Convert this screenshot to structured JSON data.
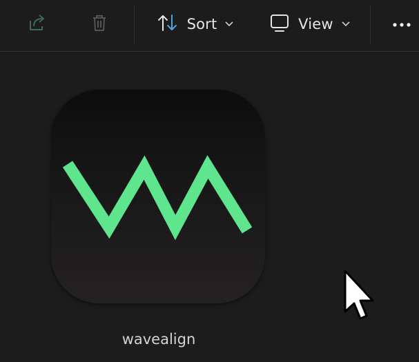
{
  "toolbar": {
    "share_icon": "share-icon",
    "delete_icon": "trash-icon",
    "sort_label": "Sort",
    "view_label": "View",
    "more_icon": "ellipsis-icon"
  },
  "files": [
    {
      "name": "wavealign",
      "icon": "wavealign-app-icon"
    }
  ],
  "colors": {
    "background": "#1c1c1c",
    "accent_green": "#5ee58e",
    "sort_icon_blue": "#4ea3e0"
  }
}
